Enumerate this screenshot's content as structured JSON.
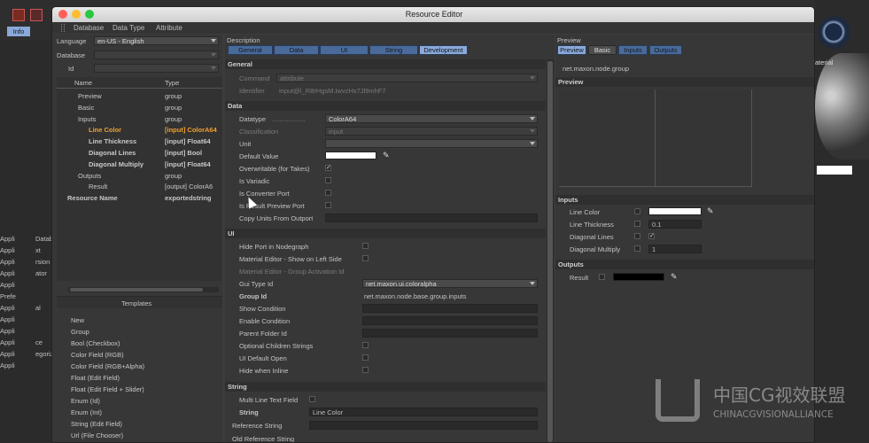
{
  "window": {
    "title": "Resource Editor"
  },
  "menu": [
    "Database",
    "Data Type",
    "Attribute"
  ],
  "bg": {
    "toolbar_info": "Info",
    "left_rows": [
      "Datab",
      "Appli",
      "xt",
      "Appli",
      "rsion",
      "Appli",
      "ator",
      "Appli",
      "",
      "Appli",
      "",
      "Prefe",
      "al",
      "Appli",
      "",
      "Appli",
      "",
      "Appli",
      "ce",
      "Appli",
      "egorized",
      "Appli",
      "",
      "Appli"
    ],
    "right_label": "aterial"
  },
  "left": {
    "language_label": "Language",
    "language_value": "en-US - English",
    "database_label": "Database",
    "id_label": "Id",
    "tree_headers": [
      "Name",
      "Type"
    ],
    "tree": [
      {
        "name": "Preview",
        "type": "group",
        "style": ""
      },
      {
        "name": "Basic",
        "type": "group",
        "style": ""
      },
      {
        "name": "Inputs",
        "type": "group",
        "style": ""
      },
      {
        "name": "Line Color",
        "type": "[input] ColorA64",
        "style": "orange"
      },
      {
        "name": "Line Thickness",
        "type": "[input] Float64",
        "style": "bold"
      },
      {
        "name": "Diagonal Lines",
        "type": "[input] Bool",
        "style": "bold"
      },
      {
        "name": "Diagonal Multiply",
        "type": "[input] Float64",
        "style": "bold"
      },
      {
        "name": "Outputs",
        "type": "group",
        "style": ""
      },
      {
        "name": "Result",
        "type": "[output] ColorA6",
        "style": ""
      },
      {
        "name": "Resource Name",
        "type": "exportedstring",
        "style": "bold"
      }
    ],
    "templates_label": "Templates",
    "templates": [
      "New",
      "Group",
      "Bool (Checkbox)",
      "Color Field (RGB)",
      "Color Field (RGB+Alpha)",
      "Float (Edit Field)",
      "Float (Edit Field + Slider)",
      "Enum (Id)",
      "Enum (Int)",
      "String (Edit Field)",
      "Url (File Chooser)"
    ]
  },
  "description": {
    "label": "Description",
    "tabs": [
      "General",
      "Data",
      "UI",
      "String",
      "Development"
    ],
    "general_header": "General",
    "command_label": "Command",
    "command_value": "attribute",
    "identifier_label": "Identifier",
    "identifier_value": "input@l_R8rHgsM.IwvzHx7Jl9mhF7",
    "data_header": "Data",
    "datatype_label": "Datatype",
    "datatype_value": "ColorA64",
    "classification_label": "Classification",
    "classification_value": "input",
    "unit_label": "Unit",
    "default_value_label": "Default Value",
    "overwritable_label": "Overwritable (for Takes)",
    "is_variadic_label": "Is Variadic",
    "is_converter_label": "Is Converter Port",
    "is_result_label": "Is Result Preview Port",
    "copy_units_label": "Copy Units From Outport",
    "ui_header": "UI",
    "hide_port_label": "Hide Port in Nodegraph",
    "material_left_label": "Material Editor - Show on Left Side",
    "material_group_label": "Material Editor - Group Activation Id",
    "gui_type_label": "Gui Type Id",
    "gui_type_value": "net.maxon.ui.coloralpha",
    "group_id_label": "Group Id",
    "group_id_value": "net.maxon.node.base.group.inputs",
    "show_condition_label": "Show Condition",
    "enable_condition_label": "Enable Condition",
    "parent_folder_label": "Parent Folder Id",
    "optional_children_label": "Optional Children Strings",
    "ui_default_open_label": "UI Default Open",
    "hide_inline_label": "Hide when Inline",
    "string_header": "String",
    "multiline_label": "Multi Line Text Field",
    "string_label": "String",
    "string_value": "Line Color",
    "reference_label": "Reference String",
    "old_reference_label": "Old Reference String"
  },
  "preview": {
    "label": "Preview",
    "tabs": [
      "Preview",
      "Basic",
      "Inputs",
      "Outputs"
    ],
    "node_id": "net.maxon.node.group",
    "preview_header": "Preview",
    "inputs_header": "Inputs",
    "line_color_label": "Line Color",
    "line_thickness_label": "Line Thickness",
    "line_thickness_value": "0.1",
    "diagonal_lines_label": "Diagonal Lines",
    "diagonal_multiply_label": "Diagonal Multiply",
    "diagonal_multiply_value": "1",
    "outputs_header": "Outputs",
    "result_label": "Result"
  },
  "watermark": {
    "cn": "中国CG视效联盟",
    "en": "CHINACGVISIONALLIANCE"
  }
}
